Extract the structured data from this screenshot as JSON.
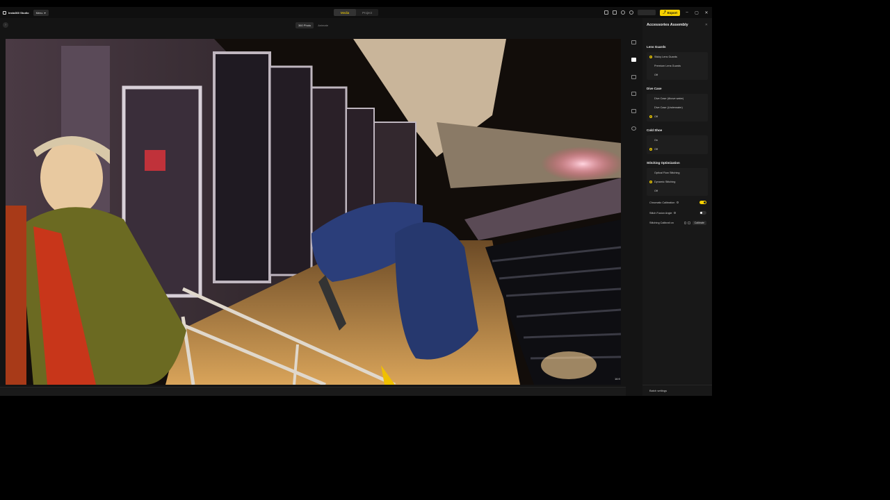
{
  "app": {
    "name": "Insta360 Studio",
    "menu_label": "Menu"
  },
  "modes": [
    {
      "label": "Media",
      "active": true
    },
    {
      "label": "Project",
      "active": false
    }
  ],
  "titlebar": {
    "login_label": "",
    "export_label": "Export",
    "icons": [
      "layout-icon",
      "file-icon",
      "settings-icon",
      "user-icon"
    ],
    "window_controls": [
      "–",
      "▢",
      "✕"
    ]
  },
  "viewer": {
    "tabs": [
      {
        "label": "360 Photo",
        "active": true
      },
      {
        "label": "Animate",
        "active": false
      }
    ],
    "fov_label": "16:9",
    "image_description_icon": "photo-360"
  },
  "panel": {
    "title": "Accessories Assembly",
    "close_icon": "✕",
    "lens_guards": {
      "title": "Lens Guards",
      "options": [
        {
          "label": "Sticky Lens Guards",
          "selected": true
        },
        {
          "label": "Premium Lens Guards",
          "selected": false
        },
        {
          "label": "Off",
          "selected": false
        }
      ]
    },
    "dive_case": {
      "title": "Dive Case",
      "options": [
        {
          "label": "Dive Case (Above water)",
          "selected": false
        },
        {
          "label": "Dive Case (Underwater)",
          "selected": false
        },
        {
          "label": "Off",
          "selected": true
        }
      ]
    },
    "cold_shoe": {
      "title": "Cold Shoe",
      "options": [
        {
          "label": "On",
          "selected": false
        },
        {
          "label": "Off",
          "selected": true
        }
      ]
    },
    "stitching": {
      "title": "Stitching Optimization",
      "options": [
        {
          "label": "Optical Flow Stitching",
          "selected": false
        },
        {
          "label": "Dynamic Stitching",
          "selected": true
        },
        {
          "label": "Off",
          "selected": false
        }
      ]
    },
    "chromatic_label": "Chromatic Calibration",
    "chromatic_on": true,
    "fusion_label": "Stitch Fusion Angle",
    "fusion_on": false,
    "calib_label": "Stitching Calibrati on",
    "calib_button": "Calibrate",
    "batch_label": "Batch settings"
  },
  "colors": {
    "accent": "#f5d000",
    "panel_bg": "#181818",
    "app_bg": "#141414"
  }
}
